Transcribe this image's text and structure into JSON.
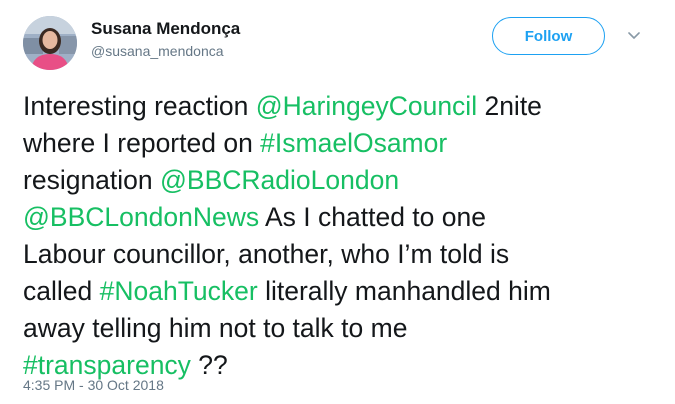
{
  "author": {
    "name": "Susana Mendonça",
    "handle": "@susana_mendonca",
    "avatar": "user-avatar-photo"
  },
  "follow_button": {
    "label": "Follow",
    "color": "#1da1f2"
  },
  "menu": {
    "icon": "chevron-down-icon"
  },
  "tweet": {
    "link_color": "#17bf63",
    "line1": {
      "t1": "Interesting reaction ",
      "m1": "@HaringeyCouncil",
      "t2": " 2nite"
    },
    "line2": {
      "t1": "where I reported on ",
      "h1": "#IsmaelOsamor"
    },
    "line3": {
      "t1": "resignation ",
      "m1": "@BBCRadioLondon"
    },
    "line4": {
      "m1": "@BBCLondonNews",
      "t1": " As I chatted to one"
    },
    "line5": {
      "t1": "Labour councillor, another, who I’m told is"
    },
    "line6": {
      "t1": "called ",
      "h1": "#NoahTucker",
      "t2": " literally manhandled him"
    },
    "line7": {
      "t1": "away telling him not to talk to me"
    },
    "line8": {
      "h1": "#transparency",
      "t1": " ??"
    }
  },
  "timestamp": "4:35 PM - 30 Oct 2018"
}
